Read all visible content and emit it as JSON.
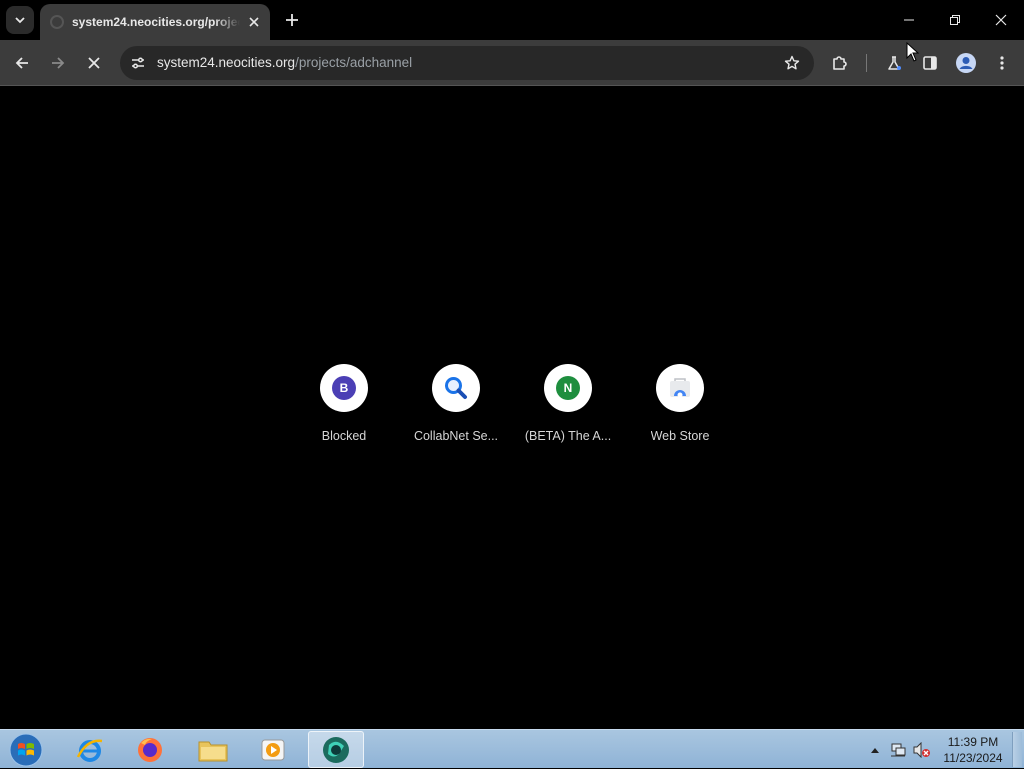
{
  "browser": {
    "tab_title": "system24.neocities.org/projects/adchannel",
    "url_host": "system24.neocities.org",
    "url_path": "/projects/adchannel",
    "icons": {
      "tab_search": "chevron-down-icon",
      "favicon": "loading-favicon-icon",
      "tab_close": "close-icon",
      "new_tab": "plus-icon",
      "minimize": "minimize-icon",
      "restore": "restore-icon",
      "close_window": "close-icon",
      "back": "arrow-left-icon",
      "forward": "arrow-right-icon",
      "stop": "stop-icon",
      "site_info": "tune-icon",
      "bookmark": "star-icon",
      "extensions": "puzzle-icon",
      "labs": "flask-icon",
      "side_panel": "side-panel-icon",
      "profile": "profile-icon",
      "menu": "kebab-menu-icon"
    }
  },
  "shortcuts": [
    {
      "label": "Blocked",
      "icon": "letter-b-icon",
      "letter": "B",
      "color": "#4b3fb5"
    },
    {
      "label": "CollabNet Se...",
      "icon": "magnifier-icon",
      "color": "#1a73e8"
    },
    {
      "label": "(BETA) The A...",
      "icon": "letter-n-icon",
      "letter": "N",
      "color": "#1e8e3e"
    },
    {
      "label": "Web Store",
      "icon": "web-store-icon",
      "color": "#4285f4"
    }
  ],
  "taskbar": {
    "apps": [
      {
        "name": "internet-explorer",
        "icon": "ie-icon"
      },
      {
        "name": "firefox",
        "icon": "firefox-icon"
      },
      {
        "name": "file-explorer",
        "icon": "folder-icon"
      },
      {
        "name": "media-player",
        "icon": "media-player-icon"
      },
      {
        "name": "browser-active",
        "icon": "browser-icon"
      }
    ],
    "time": "11:39 PM",
    "date": "11/23/2024"
  },
  "colors": {
    "page_bg": "#000000",
    "toolbar_bg": "#3c3c3c",
    "omnibox_bg": "#282828",
    "taskbar": "#9dbcd9"
  }
}
